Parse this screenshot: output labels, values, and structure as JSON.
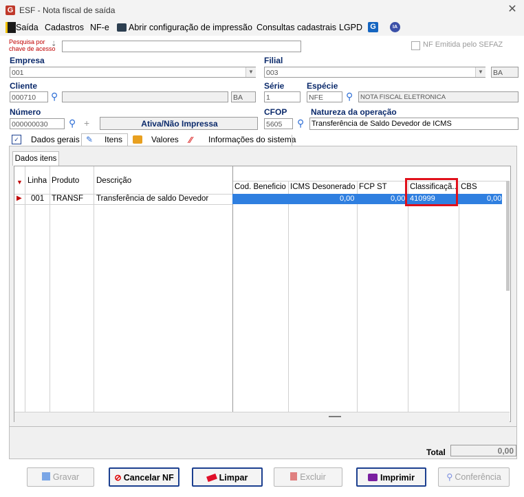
{
  "window": {
    "title": "ESF - Nota fiscal de saída"
  },
  "menu": {
    "saida": "Saída",
    "cadastros": "Cadastros",
    "nfe": "NF-e",
    "impressao": "Abrir configuração de impressão",
    "consultas": "Consultas cadastrais",
    "lgpd": "LGPD",
    "ia": "IA"
  },
  "search": {
    "label_line1": "Pesquisa por",
    "label_line2": "chave de acesso",
    "value": ""
  },
  "nf_emitida": {
    "label": "NF Emitida pelo SEFAZ",
    "checked": false
  },
  "empresa": {
    "label": "Empresa",
    "value": "001"
  },
  "filial": {
    "label": "Filial",
    "value": "003",
    "uf": "BA"
  },
  "cliente": {
    "label": "Cliente",
    "code": "000710",
    "name": "",
    "uf": "BA"
  },
  "serie": {
    "label": "Série",
    "value": "1"
  },
  "especie": {
    "label": "Espécie",
    "code": "NFE",
    "description": "NOTA FISCAL ELETRONICA"
  },
  "numero": {
    "label": "Número",
    "value": "000000030",
    "status": "Ativa/Não Impressa"
  },
  "cfop": {
    "label": "CFOP",
    "value": "5605"
  },
  "natureza": {
    "label": "Natureza da operação",
    "value": "Transferência de Saldo Devedor de ICMS"
  },
  "tabs": [
    "Dados gerais",
    "Itens",
    "Valores",
    "Informações do sistema"
  ],
  "subtab": "Dados itens",
  "grid": {
    "left_headers": [
      "Linha",
      "Produto",
      "Descrição"
    ],
    "right_headers": [
      "Cod. Beneficio",
      "ICMS Desonerado",
      "FCP ST",
      "Classificaçã...",
      "CBS"
    ],
    "rows": [
      {
        "linha": "001",
        "produto": "TRANSF",
        "descricao": "Transferência de saldo Devedor",
        "cod_beneficio": "",
        "icms_desonerado": "0,00",
        "fcp_st": "0,00",
        "classificacao": "410999",
        "cbs": "0,00"
      }
    ]
  },
  "total": {
    "label": "Total",
    "value": "0,00"
  },
  "buttons": {
    "gravar": "Gravar",
    "cancelar": "Cancelar NF",
    "limpar": "Limpar",
    "excluir": "Excluir",
    "imprimir": "Imprimir",
    "conferencia": "Conferência"
  },
  "colors": {
    "accent_blue": "#0b2a6b",
    "selection": "#2f7fe0",
    "highlight": "#e0101a"
  }
}
